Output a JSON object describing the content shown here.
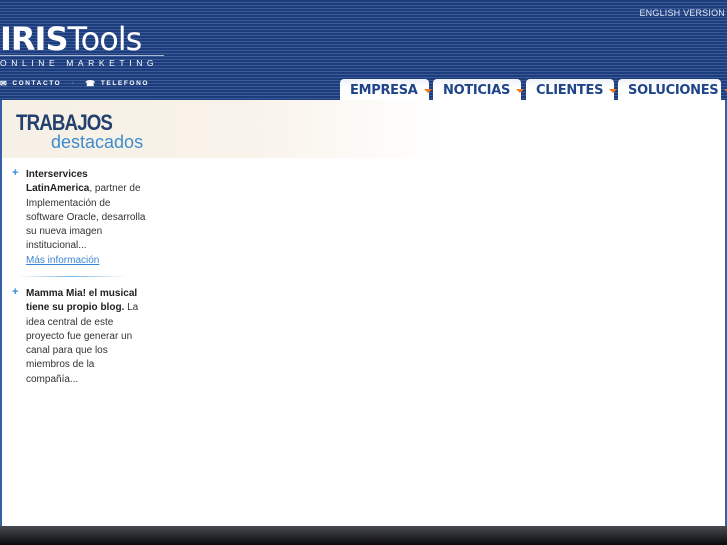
{
  "header": {
    "english_version": "ENGLISH VERSION",
    "logo_main": "IRIS",
    "logo_tools": "Tools",
    "logo_sub": "ONLINE MARKETING",
    "contacto": "CONTACTO",
    "telefono": "TELEFONO"
  },
  "nav": {
    "tabs": [
      {
        "label": "EMPRESA"
      },
      {
        "label": "NOTICIAS"
      },
      {
        "label": "CLIENTES"
      },
      {
        "label": "SOLUCIONES"
      }
    ]
  },
  "section": {
    "title": "TRABAJOS",
    "subtitle": "destacados"
  },
  "items": [
    {
      "bold": "Interservices LatinAmerica",
      "text": ", partner de Implementación de software Oracle, desarrolla su nueva imagen institucional...",
      "link": "Más información"
    },
    {
      "bold": "Mamma Mia! el musical tiene su propio blog.",
      "text": " La idea central de este proyecto fue generar un canal para que los miembros de la compañía..."
    }
  ],
  "colors": {
    "brand_blue": "#1c3c7c",
    "accent_orange": "#f07a20",
    "link_blue": "#3b86d4"
  }
}
